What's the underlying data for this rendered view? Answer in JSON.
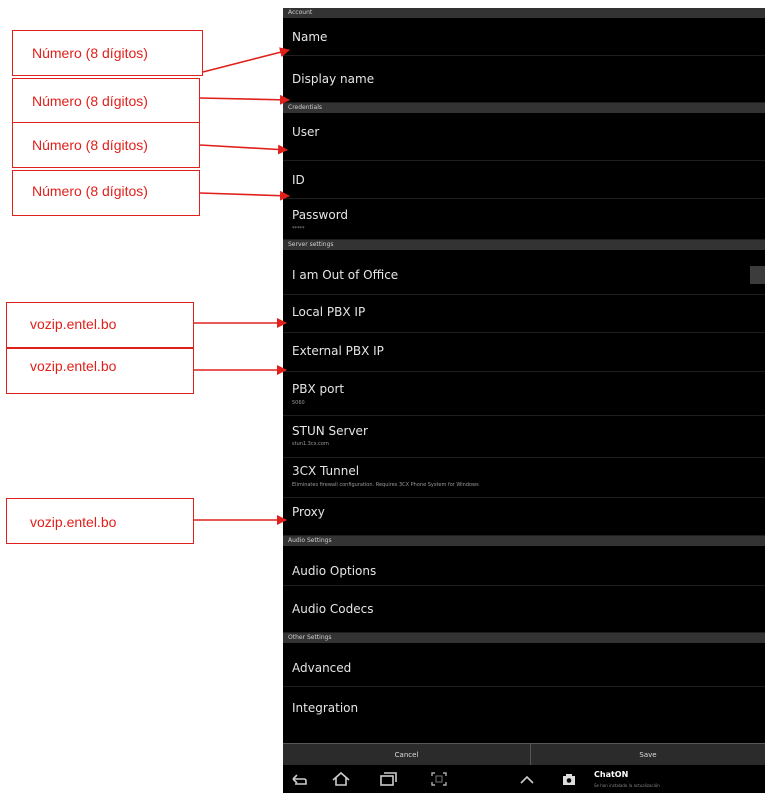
{
  "sections": {
    "account": "Account",
    "credentials": "Credentials",
    "server": "Server settings",
    "audio": "Audio Settings",
    "other": "Other Settings"
  },
  "rows": {
    "name": {
      "title": "Name"
    },
    "display_name": {
      "title": "Display name"
    },
    "user": {
      "title": "User"
    },
    "id": {
      "title": "ID"
    },
    "password": {
      "title": "Password",
      "sub": "*****"
    },
    "out_of_office": {
      "title": "I am Out of Office"
    },
    "local_pbx": {
      "title": "Local PBX IP"
    },
    "external_pbx": {
      "title": "External PBX IP"
    },
    "pbx_port": {
      "title": "PBX port",
      "sub": "5060"
    },
    "stun": {
      "title": "STUN Server",
      "sub": "stun1.3cx.com"
    },
    "tunnel": {
      "title": "3CX Tunnel",
      "sub": "Eliminates firewall configuration. Requires 3CX Phone System for Windows"
    },
    "proxy": {
      "title": "Proxy"
    },
    "audio_options": {
      "title": "Audio Options"
    },
    "audio_codecs": {
      "title": "Audio Codecs"
    },
    "advanced": {
      "title": "Advanced"
    },
    "integration": {
      "title": "Integration"
    }
  },
  "buttons": {
    "cancel": "Cancel",
    "save": "Save"
  },
  "notification": {
    "app": "ChatON",
    "text": "Se han instalado la actualización"
  },
  "annotations": {
    "digits": "Número (8 dígitos)",
    "domain": "vozip.entel.bo"
  },
  "colors": {
    "annotation": "#e0201b",
    "section_bg": "#333333",
    "screen_bg": "#000000"
  }
}
